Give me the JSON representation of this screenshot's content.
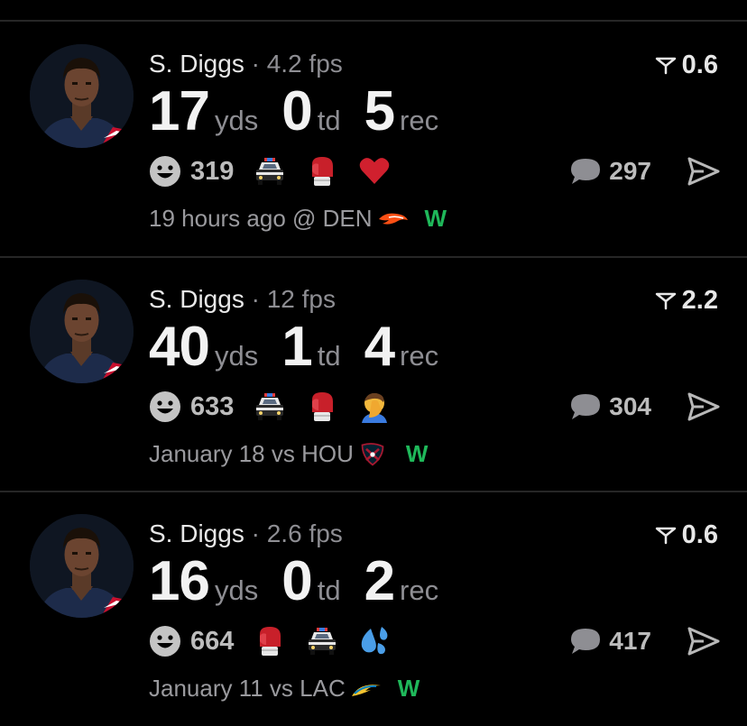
{
  "colors": {
    "background": "#000000",
    "win": "#1fb85a",
    "muted": "#8e8e93"
  },
  "posts": [
    {
      "player": "S. Diggs",
      "sep": "·",
      "fps": "4.2 fps",
      "score": "0.6",
      "yds": "17",
      "yds_unit": "yds",
      "td": "0",
      "td_unit": "td",
      "rec": "5",
      "rec_unit": "rec",
      "smiley_count": "319",
      "emojis": [
        "police-car-icon",
        "boxing-glove-icon",
        "heart-icon"
      ],
      "comments": "297",
      "meta": "19 hours ago @ DEN",
      "team_logo": "broncos-logo-icon",
      "result": "W"
    },
    {
      "player": "S. Diggs",
      "sep": "·",
      "fps": "12 fps",
      "score": "2.2",
      "yds": "40",
      "yds_unit": "yds",
      "td": "1",
      "td_unit": "td",
      "rec": "4",
      "rec_unit": "rec",
      "smiley_count": "633",
      "emojis": [
        "police-car-icon",
        "boxing-glove-icon",
        "facepalm-icon"
      ],
      "comments": "304",
      "meta": "January 18 vs HOU",
      "team_logo": "texans-logo-icon",
      "result": "W"
    },
    {
      "player": "S. Diggs",
      "sep": "·",
      "fps": "2.6 fps",
      "score": "0.6",
      "yds": "16",
      "yds_unit": "yds",
      "td": "0",
      "td_unit": "td",
      "rec": "2",
      "rec_unit": "rec",
      "smiley_count": "664",
      "emojis": [
        "boxing-glove-icon",
        "police-car-icon",
        "sweat-droplets-icon"
      ],
      "comments": "417",
      "meta": "January 11 vs LAC",
      "team_logo": "chargers-logo-icon",
      "result": "W"
    }
  ]
}
